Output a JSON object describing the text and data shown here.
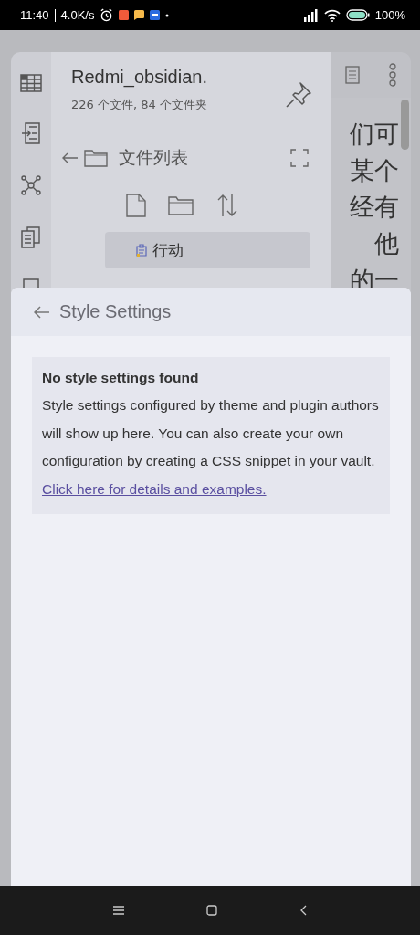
{
  "status_bar": {
    "time": "11:40",
    "net_speed": "4.0K/s",
    "battery": "100%"
  },
  "sidebar": {
    "vault_name": "Redmi_obsidian.",
    "stats": "226 个文件, 84 个文件夹",
    "nav_title": "文件列表",
    "tree": [
      {
        "label": "行动",
        "selected": true
      }
    ]
  },
  "editor": {
    "lines": [
      "们可",
      "某个",
      "经有",
      "他",
      "的一"
    ]
  },
  "sheet": {
    "title": "Style Settings",
    "notice": {
      "heading": "No style settings found",
      "body": "Style settings configured by theme and plugin authors will show up here. You can also create your own configuration by creating a CSS snippet in your vault.",
      "link": "Click here for details and examples."
    }
  }
}
